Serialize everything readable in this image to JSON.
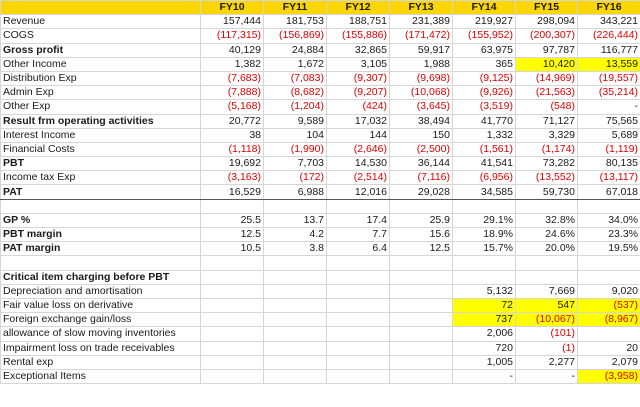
{
  "colors": {
    "header_bg": "#fcd600",
    "highlight": "#ffff00",
    "negative": "#e00000"
  },
  "header": {
    "label": "",
    "years": [
      "FY10",
      "FY11",
      "FY12",
      "FY13",
      "FY14",
      "FY15",
      "FY16"
    ]
  },
  "rows": [
    {
      "label": "Revenue",
      "bold": false,
      "values": [
        "157,444",
        "181,753",
        "188,751",
        "231,389",
        "219,927",
        "298,094",
        "343,221"
      ]
    },
    {
      "label": "COGS",
      "bold": false,
      "values": [
        "(117,315)",
        "(156,869)",
        "(155,886)",
        "(171,472)",
        "(155,952)",
        "(200,307)",
        "(226,444)"
      ]
    },
    {
      "label": "Gross profit",
      "bold": true,
      "topRule": true,
      "values": [
        "40,129",
        "24,884",
        "32,865",
        "59,917",
        "63,975",
        "97,787",
        "116,777"
      ]
    },
    {
      "label": "Other Income",
      "bold": false,
      "values": [
        "1,382",
        "1,672",
        "3,105",
        "1,988",
        "365",
        "10,420",
        "13,559"
      ],
      "hl": [
        5,
        6
      ]
    },
    {
      "label": "Distribution Exp",
      "bold": false,
      "values": [
        "(7,683)",
        "(7,083)",
        "(9,307)",
        "(9,698)",
        "(9,125)",
        "(14,969)",
        "(19,557)"
      ]
    },
    {
      "label": "Admin Exp",
      "bold": false,
      "values": [
        "(7,888)",
        "(8,682)",
        "(9,207)",
        "(10,068)",
        "(9,926)",
        "(21,563)",
        "(35,214)"
      ]
    },
    {
      "label": "Other Exp",
      "bold": false,
      "values": [
        "(5,168)",
        "(1,204)",
        "(424)",
        "(3,645)",
        "(3,519)",
        "(548)",
        "-"
      ]
    },
    {
      "label": "Result frm operating activities",
      "bold": true,
      "topRule": true,
      "values": [
        "20,772",
        "9,589",
        "17,032",
        "38,494",
        "41,770",
        "71,127",
        "75,565"
      ]
    },
    {
      "label": "Interest Income",
      "bold": false,
      "values": [
        "38",
        "104",
        "144",
        "150",
        "1,332",
        "3,329",
        "5,689"
      ]
    },
    {
      "label": "Financial Costs",
      "bold": false,
      "values": [
        "(1,118)",
        "(1,990)",
        "(2,646)",
        "(2,500)",
        "(1,561)",
        "(1,174)",
        "(1,119)"
      ]
    },
    {
      "label": "PBT",
      "bold": true,
      "topRule": true,
      "values": [
        "19,692",
        "7,703",
        "14,530",
        "36,144",
        "41,541",
        "73,282",
        "80,135"
      ]
    },
    {
      "label": "Income tax Exp",
      "bold": false,
      "values": [
        "(3,163)",
        "(172)",
        "(2,514)",
        "(7,116)",
        "(6,956)",
        "(13,552)",
        "(13,117)"
      ]
    },
    {
      "label": "PAT",
      "bold": true,
      "topRule": true,
      "botRule": true,
      "values": [
        "16,529",
        "6,988",
        "12,016",
        "29,028",
        "34,585",
        "59,730",
        "67,018"
      ]
    },
    {
      "label": "",
      "blank": true,
      "values": [
        "",
        "",
        "",
        "",
        "",
        "",
        ""
      ]
    },
    {
      "label": "GP %",
      "bold": true,
      "values": [
        "25.5",
        "13.7",
        "17.4",
        "25.9",
        "29.1%",
        "32.8%",
        "34.0%"
      ]
    },
    {
      "label": "PBT margin",
      "bold": true,
      "values": [
        "12.5",
        "4.2",
        "7.7",
        "15.6",
        "18.9%",
        "24.6%",
        "23.3%"
      ]
    },
    {
      "label": "PAT margin",
      "bold": true,
      "values": [
        "10.5",
        "3.8",
        "6.4",
        "12.5",
        "15.7%",
        "20.0%",
        "19.5%"
      ]
    },
    {
      "label": "",
      "blank": true,
      "values": [
        "",
        "",
        "",
        "",
        "",
        "",
        ""
      ]
    },
    {
      "label": "Critical item charging before PBT",
      "bold": true,
      "values": [
        "",
        "",
        "",
        "",
        "",
        "",
        ""
      ]
    },
    {
      "label": "Depreciation and amortisation",
      "bold": false,
      "values": [
        "",
        "",
        "",
        "",
        "5,132",
        "7,669",
        "9,020"
      ]
    },
    {
      "label": "Fair value loss on derivative",
      "bold": false,
      "values": [
        "",
        "",
        "",
        "",
        "72",
        "547",
        "(537)"
      ],
      "hl": [
        4,
        5,
        6
      ]
    },
    {
      "label": "Foreign exchange gain/loss",
      "bold": false,
      "values": [
        "",
        "",
        "",
        "",
        "737",
        "(10,067)",
        "(8,967)"
      ],
      "hl": [
        4,
        5,
        6
      ]
    },
    {
      "label": "allowance of slow moving inventories",
      "bold": false,
      "values": [
        "",
        "",
        "",
        "",
        "2,006",
        "(101)",
        ""
      ]
    },
    {
      "label": "Impairment loss on trade receivables",
      "bold": false,
      "values": [
        "",
        "",
        "",
        "",
        "720",
        "(1)",
        "20"
      ]
    },
    {
      "label": "Rental exp",
      "bold": false,
      "values": [
        "",
        "",
        "",
        "",
        "1,005",
        "2,277",
        "2,079"
      ]
    },
    {
      "label": "Exceptional Items",
      "bold": false,
      "values": [
        "",
        "",
        "",
        "",
        "-",
        "-",
        "(3,958)"
      ],
      "hl": [
        6
      ]
    }
  ]
}
